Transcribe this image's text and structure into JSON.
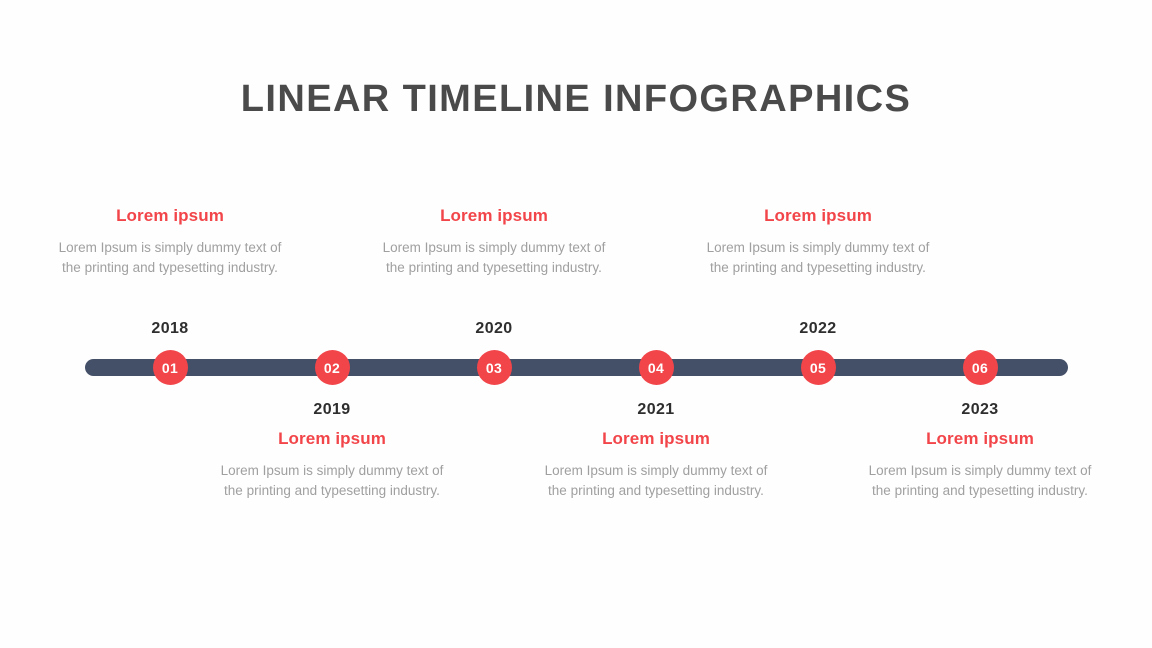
{
  "title": "LINEAR TIMELINE INFOGRAPHICS",
  "colors": {
    "accent_red": "#f2454a",
    "bar_slate": "#445068",
    "title_gray": "#4a4a4a",
    "year_dark": "#2e2e2e",
    "body_gray": "#a0a0a0",
    "background": "#fefefe",
    "marker_text": "#ffffff"
  },
  "timeline": {
    "milestones": [
      {
        "number": "01",
        "year": "2018",
        "position": "above",
        "heading": "Lorem ipsum",
        "body": "Lorem Ipsum is simply dummy text of the printing and typesetting industry."
      },
      {
        "number": "02",
        "year": "2019",
        "position": "below",
        "heading": "Lorem ipsum",
        "body": "Lorem Ipsum is simply dummy text of the printing and typesetting industry."
      },
      {
        "number": "03",
        "year": "2020",
        "position": "above",
        "heading": "Lorem ipsum",
        "body": "Lorem Ipsum is simply dummy text of the printing and typesetting industry."
      },
      {
        "number": "04",
        "year": "2021",
        "position": "below",
        "heading": "Lorem ipsum",
        "body": "Lorem Ipsum is simply dummy text of the printing and typesetting industry."
      },
      {
        "number": "05",
        "year": "2022",
        "position": "above",
        "heading": "Lorem ipsum",
        "body": "Lorem Ipsum is simply dummy text of the printing and typesetting industry."
      },
      {
        "number": "06",
        "year": "2023",
        "position": "below",
        "heading": "Lorem ipsum",
        "body": "Lorem Ipsum is simply dummy text of the printing and typesetting industry."
      }
    ]
  }
}
